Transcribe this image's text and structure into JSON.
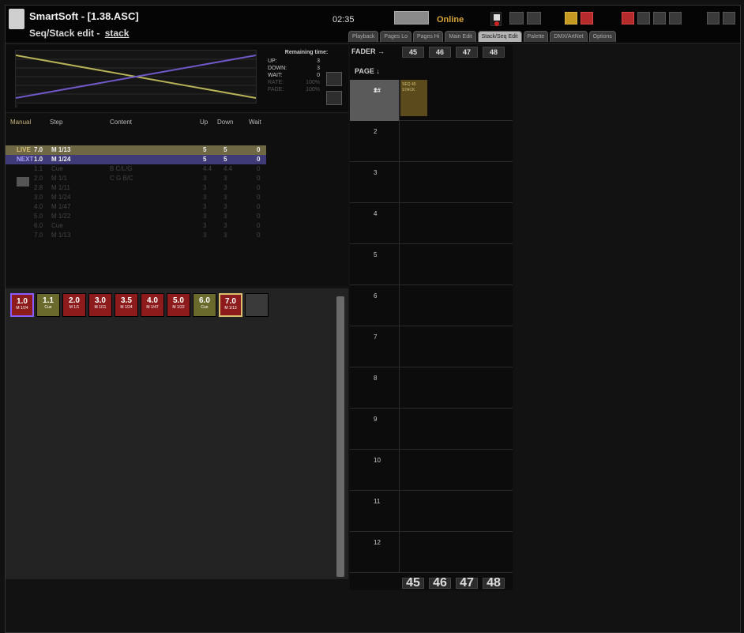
{
  "window": {
    "app_title": "SmartSoft - [1.38.ASC]",
    "subtitle_prefix": "Seq/Stack edit -",
    "subtitle_stack": "stack",
    "clock": "02:35",
    "online_status": "Online",
    "tabs": [
      "Playback",
      "Pages Lo",
      "Pages Hi",
      "Main Edit",
      "Stack/Seq Edit",
      "Palette",
      "DMX/ArtNet",
      "Options"
    ],
    "active_tab": "Stack/Seq Edit"
  },
  "remaining": {
    "header": "Remaining time:",
    "rows": [
      {
        "label": "UP:",
        "value": "3"
      },
      {
        "label": "DOWN:",
        "value": "3"
      },
      {
        "label": "WAIT:",
        "value": "0"
      },
      {
        "label": "RATE:",
        "value": "100%"
      },
      {
        "label": "FADE:",
        "value": "100%"
      }
    ]
  },
  "step_table": {
    "headers": {
      "manual": "Manual",
      "step": "Step",
      "content": "Content",
      "up": "Up",
      "down": "Down",
      "wait": "Wait"
    },
    "rows": [
      {
        "tag": "LIVE",
        "step": "7.0",
        "content": "M 1/13",
        "extra": "",
        "up": "5",
        "down": "5",
        "wait": "0",
        "kind": "live"
      },
      {
        "tag": "NEXT",
        "step": "1.0",
        "content": "M 1/24",
        "extra": "",
        "up": "5",
        "down": "5",
        "wait": "0",
        "kind": "next"
      },
      {
        "tag": "",
        "step": "1.1",
        "content": "Cue",
        "extra": "B C/L/G",
        "up": "4.4",
        "down": "4.4",
        "wait": "0",
        "kind": "dim"
      },
      {
        "tag": "",
        "step": "2.0",
        "content": "M 1/1",
        "extra": "C G B/C",
        "up": "3",
        "down": "3",
        "wait": "0",
        "kind": "dim"
      },
      {
        "tag": "",
        "step": "2.8",
        "content": "M 1/11",
        "extra": "",
        "up": "3",
        "down": "3",
        "wait": "0",
        "kind": "dim"
      },
      {
        "tag": "",
        "step": "3.0",
        "content": "M 1/24",
        "extra": "",
        "up": "3",
        "down": "3",
        "wait": "0",
        "kind": "dim"
      },
      {
        "tag": "",
        "step": "4.0",
        "content": "M 1/47",
        "extra": "",
        "up": "3",
        "down": "3",
        "wait": "0",
        "kind": "dim"
      },
      {
        "tag": "",
        "step": "5.0",
        "content": "M 1/22",
        "extra": "",
        "up": "3",
        "down": "3",
        "wait": "0",
        "kind": "dim"
      },
      {
        "tag": "",
        "step": "6.0",
        "content": "Cue",
        "extra": "",
        "up": "3",
        "down": "3",
        "wait": "0",
        "kind": "dim"
      },
      {
        "tag": "",
        "step": "7.0",
        "content": "M 1/13",
        "extra": "",
        "up": "3",
        "down": "3",
        "wait": "0",
        "kind": "dim"
      }
    ]
  },
  "chips": [
    {
      "num": "1.0",
      "sub": "M 1/24",
      "color": "red",
      "sel": "next"
    },
    {
      "num": "1.1",
      "sub": "Cue",
      "color": "olive",
      "sel": ""
    },
    {
      "num": "2.0",
      "sub": "M 1/1",
      "color": "red",
      "sel": ""
    },
    {
      "num": "3.0",
      "sub": "M 1/11",
      "color": "red",
      "sel": ""
    },
    {
      "num": "3.5",
      "sub": "M 1/24",
      "color": "red",
      "sel": ""
    },
    {
      "num": "4.0",
      "sub": "M 1/47",
      "color": "red",
      "sel": ""
    },
    {
      "num": "5.0",
      "sub": "M 1/22",
      "color": "red",
      "sel": ""
    },
    {
      "num": "6.0",
      "sub": "Cue",
      "color": "olive",
      "sel": ""
    },
    {
      "num": "7.0",
      "sub": "M 1/13",
      "color": "red",
      "sel": "live"
    },
    {
      "num": "",
      "sub": "",
      "color": "empty",
      "sel": ""
    }
  ],
  "fader_grid": {
    "fader_label": "FADER →",
    "page_label": "PAGE ↓",
    "faders": [
      "45",
      "46",
      "47",
      "48"
    ],
    "pages": [
      "1",
      "2",
      "3",
      "4",
      "5",
      "6",
      "7",
      "8",
      "9",
      "10",
      "11",
      "12"
    ],
    "first_mark": "##",
    "seq_text": "SEQ 45\nSTACK"
  },
  "colors": {
    "accent_live": "#6f6844",
    "accent_next": "#3f3a78",
    "chip_red": "#8e1b1b",
    "online": "#d6a43a"
  }
}
